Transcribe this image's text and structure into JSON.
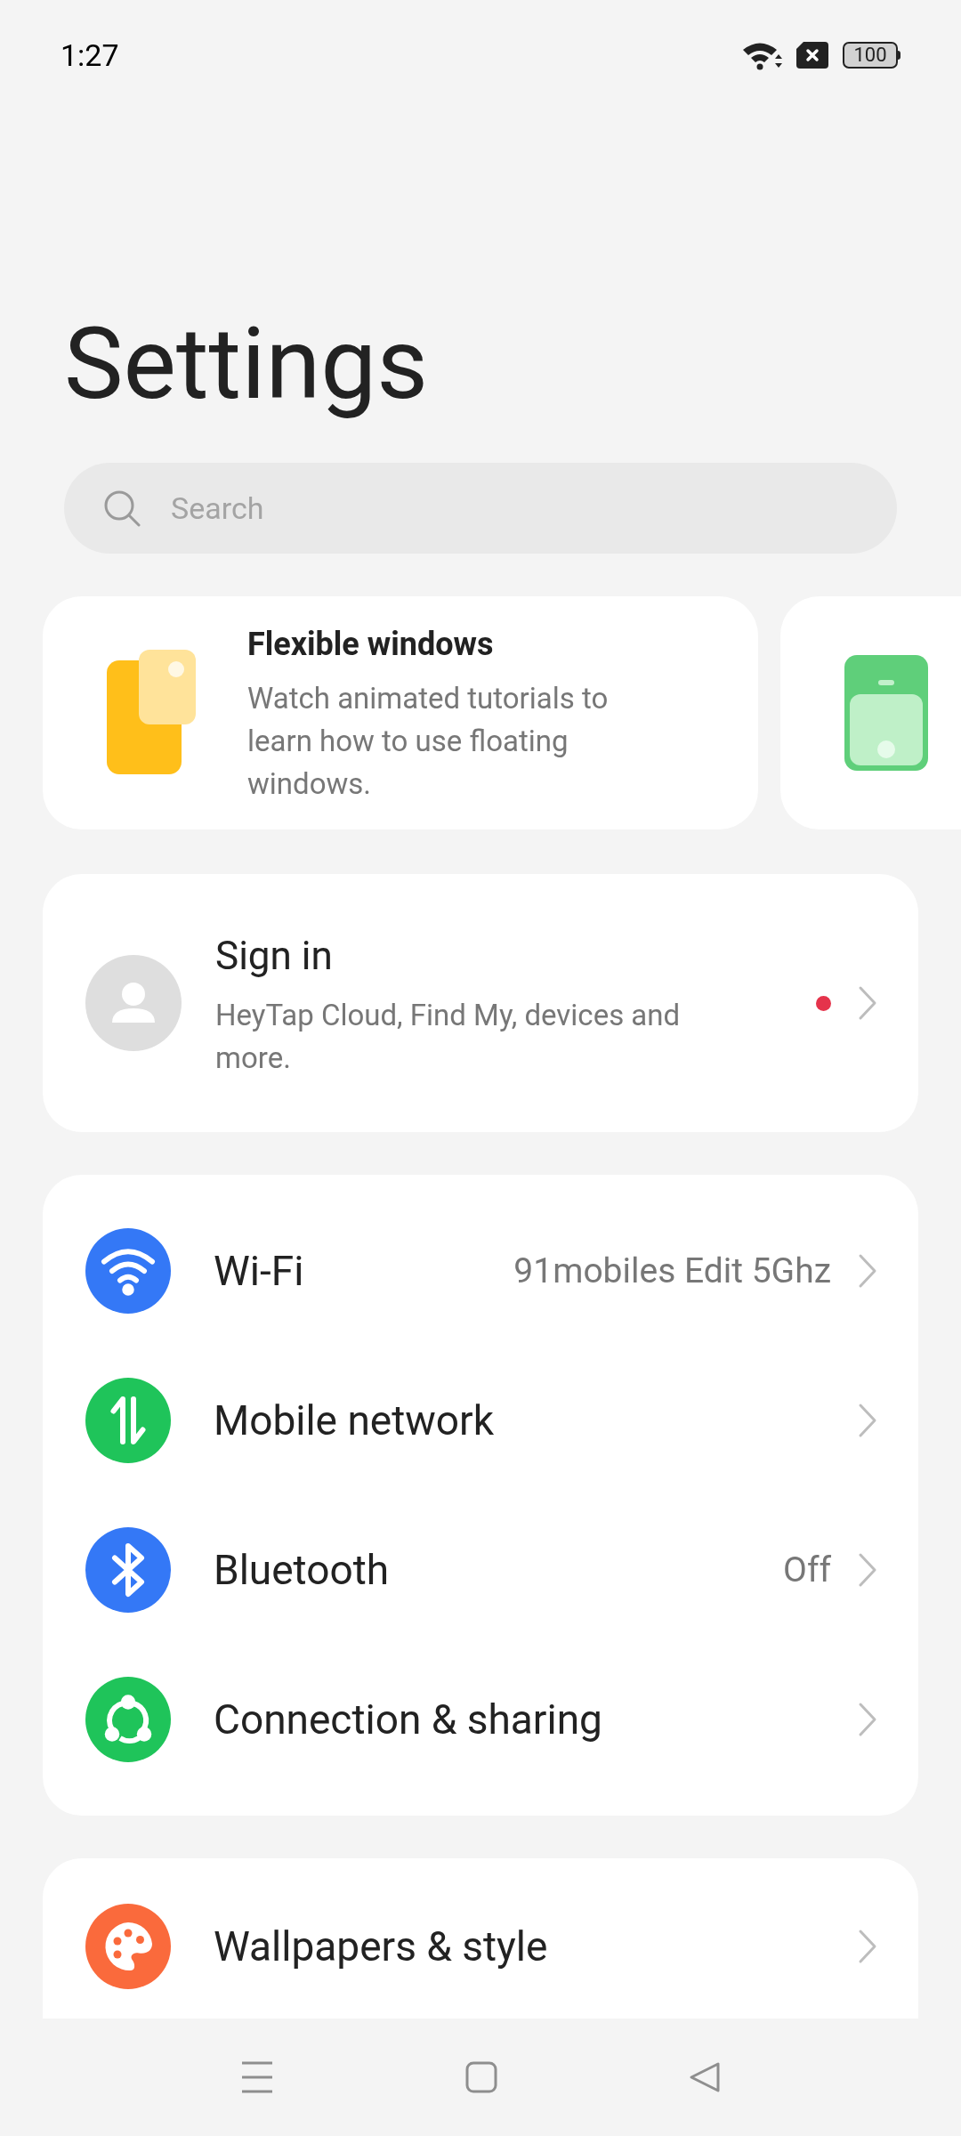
{
  "status_bar": {
    "time": "1:27",
    "battery": "100"
  },
  "title": "Settings",
  "search": {
    "placeholder": "Search"
  },
  "tips": [
    {
      "kind": "floating",
      "title": "Flexible windows",
      "description": "Watch animated tutorials to learn how to use floating windows."
    },
    {
      "kind": "phone"
    }
  ],
  "account": {
    "title": "Sign in",
    "subtitle": "HeyTap Cloud, Find My, devices and more.",
    "notification": true
  },
  "groups": [
    {
      "items": [
        {
          "kind": "wifi",
          "label": "Wi-Fi",
          "value": "91mobiles Edit 5Ghz",
          "color": "#3478f6"
        },
        {
          "kind": "mobile",
          "label": "Mobile network",
          "color": "#1fc45a"
        },
        {
          "kind": "bluetooth",
          "label": "Bluetooth",
          "value": "Off",
          "color": "#3478f6"
        },
        {
          "kind": "sharing",
          "label": "Connection & sharing",
          "color": "#1fc45a"
        }
      ]
    },
    {
      "items": [
        {
          "kind": "palette",
          "label": "Wallpapers & style",
          "color": "#fa6a3c"
        }
      ]
    }
  ]
}
